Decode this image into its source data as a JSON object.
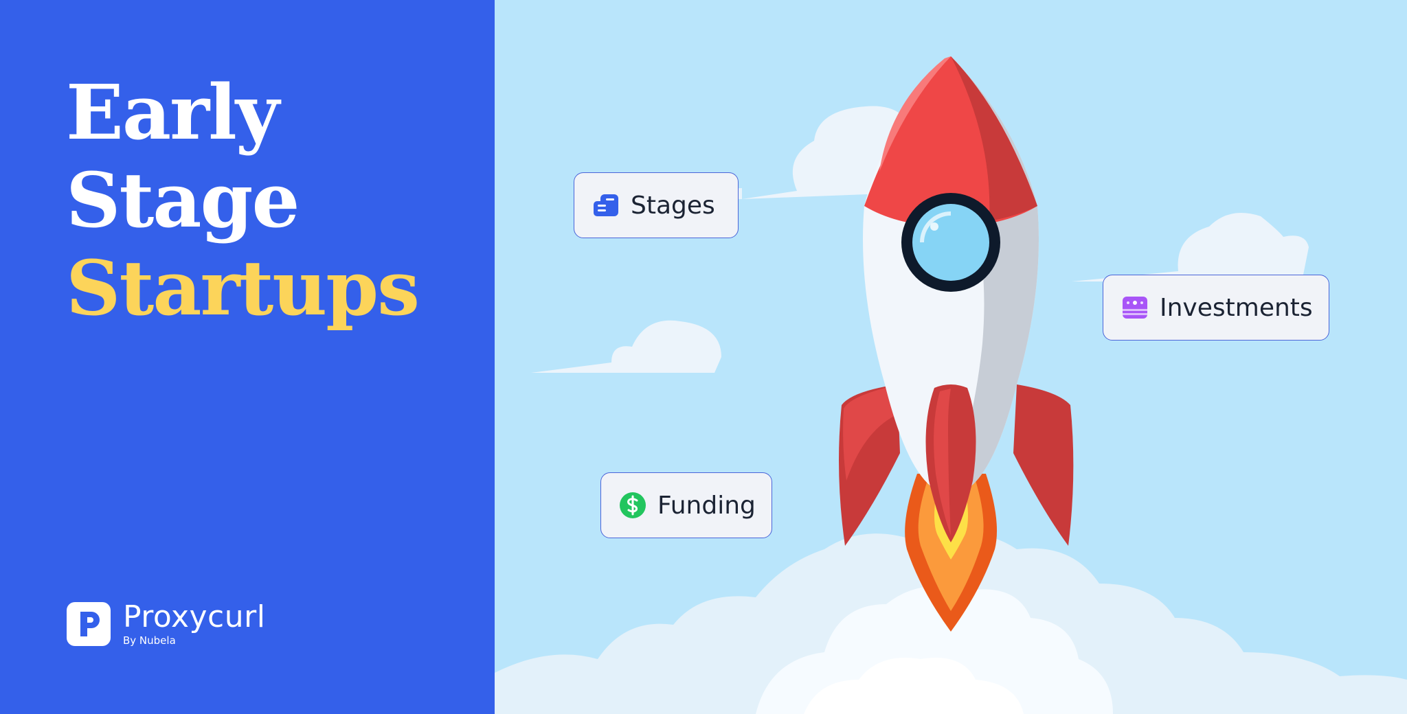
{
  "headline": {
    "line1": "Early",
    "line2": "Stage",
    "line3": "Startups"
  },
  "brand": {
    "name": "Proxycurl",
    "tagline": "By Nubela"
  },
  "tags": {
    "stages": "Stages",
    "investments": "Investments",
    "funding": "Funding"
  },
  "colors": {
    "panel": "#3460ea",
    "sky": "#b9e5fb",
    "accent_yellow": "#fcd45a",
    "rocket_red": "#ef4a4a",
    "funding_green": "#22c55e",
    "investments_purple": "#a855f7"
  },
  "icons": {
    "stages": "stages-list-icon",
    "investments": "investments-card-icon",
    "funding": "dollar-icon",
    "brand": "proxycurl-logo-icon"
  }
}
